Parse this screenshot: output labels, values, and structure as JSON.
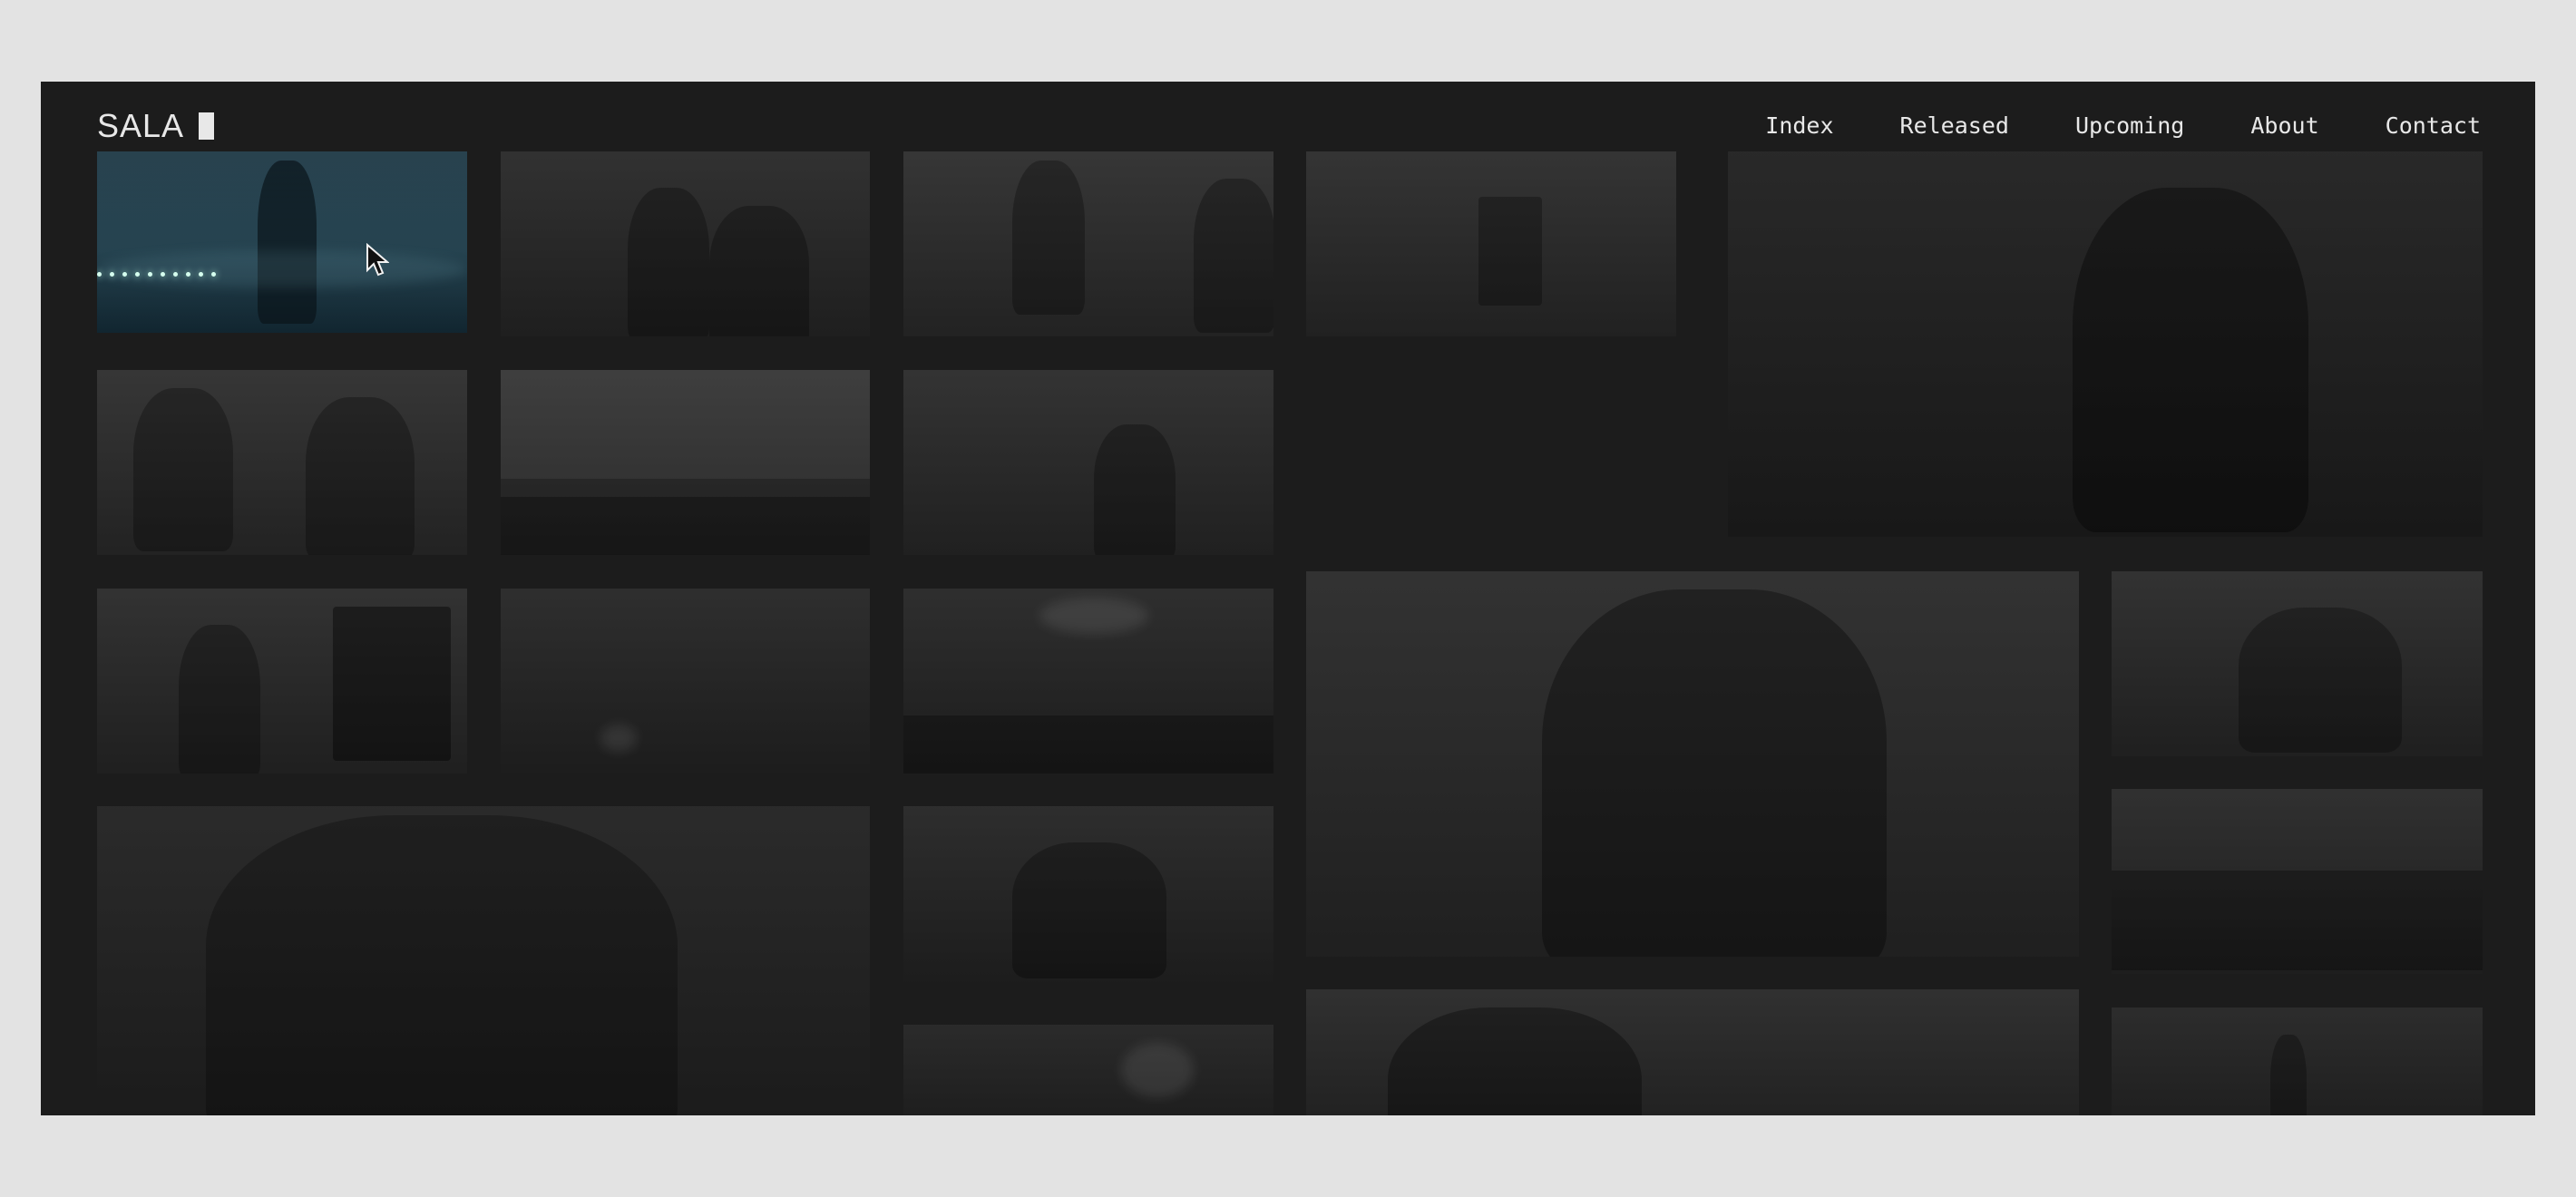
{
  "app": {
    "brand": "SALA"
  },
  "nav": {
    "items": [
      "Index",
      "Released",
      "Upcoming",
      "About",
      "Contact"
    ]
  },
  "gallery": {
    "tiles": [
      "t1",
      "t2",
      "t3",
      "t4",
      "t5",
      "t6",
      "t7",
      "t8",
      "t9",
      "t10",
      "t11",
      "t12",
      "t13",
      "t14",
      "t15",
      "t16",
      "t17",
      "t18",
      "t19"
    ]
  }
}
